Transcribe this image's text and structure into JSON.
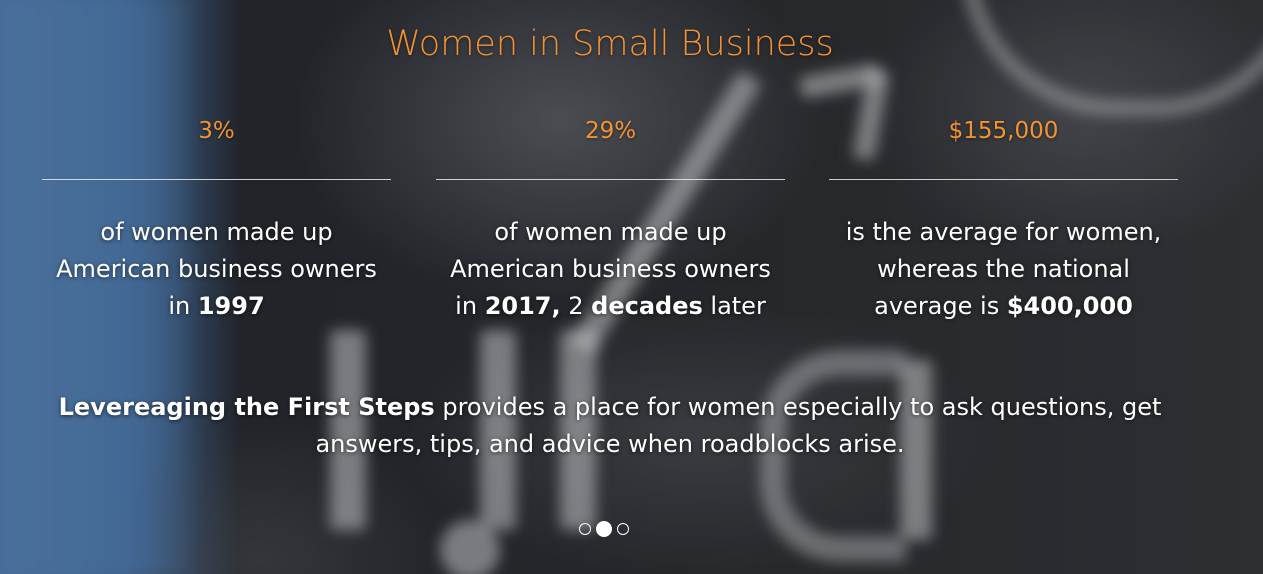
{
  "section": {
    "title": "Women in Small Business"
  },
  "stats": [
    {
      "value": "3%",
      "desc_parts": [
        "of women made up",
        "American business owners",
        "in ",
        "1997"
      ]
    },
    {
      "value": "29%",
      "desc_parts": [
        "of women made up",
        "American business owners",
        "in ",
        "2017,",
        " 2 ",
        "decades",
        " later"
      ]
    },
    {
      "value": "$155,000",
      "desc_parts": [
        "is the average for women,",
        "whereas the national",
        "average is ",
        "$400,000"
      ]
    }
  ],
  "footer": {
    "emphasis": "Levereaging the First Steps",
    "text": " provides a place for women especially to ask questions, get answers, tips, and advice when roadblocks arise."
  },
  "carousel": {
    "slide_count": 3,
    "active_index": 1
  },
  "colors": {
    "accent": "#f39233",
    "text": "#ffffff",
    "rule": "#ebebeb"
  }
}
